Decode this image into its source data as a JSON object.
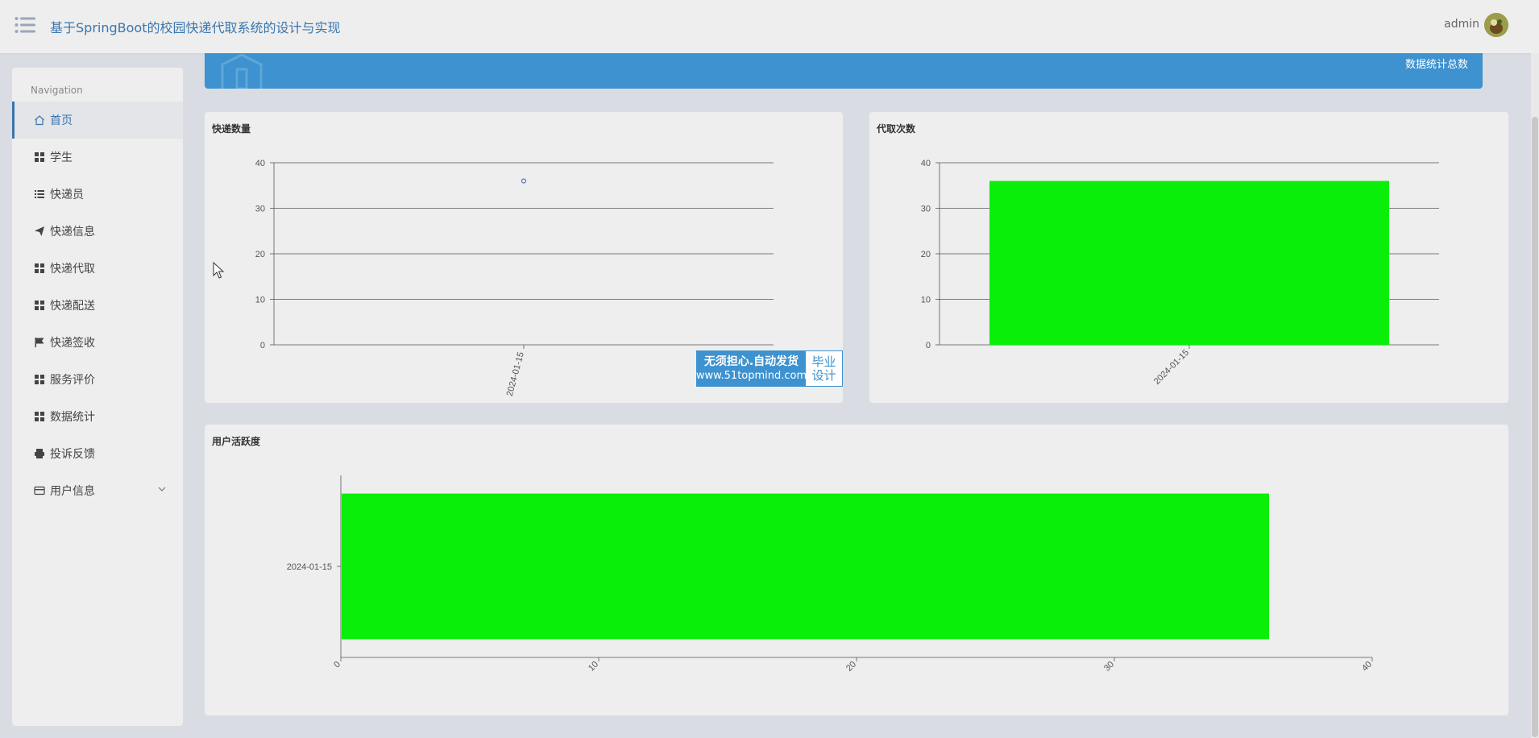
{
  "header": {
    "title": "基于SpringBoot的校园快递代取系统的设计与实现",
    "user": "admin",
    "menu_icon": "list-menu-icon",
    "avatar_icon": "user-avatar-icon"
  },
  "sidebar": {
    "heading": "Navigation",
    "items": [
      {
        "label": "首页",
        "icon": "home-icon",
        "active": true
      },
      {
        "label": "学生",
        "icon": "grid-icon"
      },
      {
        "label": "快递员",
        "icon": "list-icon"
      },
      {
        "label": "快递信息",
        "icon": "send-icon"
      },
      {
        "label": "快递代取",
        "icon": "grid-icon"
      },
      {
        "label": "快递配送",
        "icon": "grid-icon"
      },
      {
        "label": "快递签收",
        "icon": "flag-icon"
      },
      {
        "label": "服务评价",
        "icon": "grid-icon"
      },
      {
        "label": "数据统计",
        "icon": "grid-icon"
      },
      {
        "label": "投诉反馈",
        "icon": "printer-icon"
      },
      {
        "label": "用户信息",
        "icon": "card-icon",
        "has_submenu": true
      }
    ]
  },
  "banner": {
    "label": "数据统计总数"
  },
  "watermark": {
    "line1": "无须担心.自动发货",
    "line2": "www.51topmind.com",
    "right1": "毕业",
    "right2": "设计"
  },
  "colors": {
    "accent": "#3a76ad",
    "banner": "#3d92cf",
    "bar": "#0aef0a",
    "point": "#5470c6"
  },
  "chart_data": [
    {
      "type": "scatter",
      "title": "快递数量",
      "x": [
        "2024-01-15"
      ],
      "values": [
        36
      ],
      "yticks": [
        0,
        10,
        20,
        30,
        40
      ],
      "ylim": [
        0,
        40
      ],
      "grid": true
    },
    {
      "type": "bar",
      "title": "代取次数",
      "categories": [
        "2024-01-15"
      ],
      "values": [
        36
      ],
      "yticks": [
        0,
        10,
        20,
        30,
        40
      ],
      "ylim": [
        0,
        40
      ],
      "grid": true
    },
    {
      "type": "bar",
      "orientation": "horizontal",
      "title": "用户活跃度",
      "categories": [
        "2024-01-15"
      ],
      "values": [
        36
      ],
      "xticks": [
        0,
        10,
        20,
        30,
        40
      ],
      "xlim": [
        0,
        40
      ],
      "grid": false
    }
  ]
}
